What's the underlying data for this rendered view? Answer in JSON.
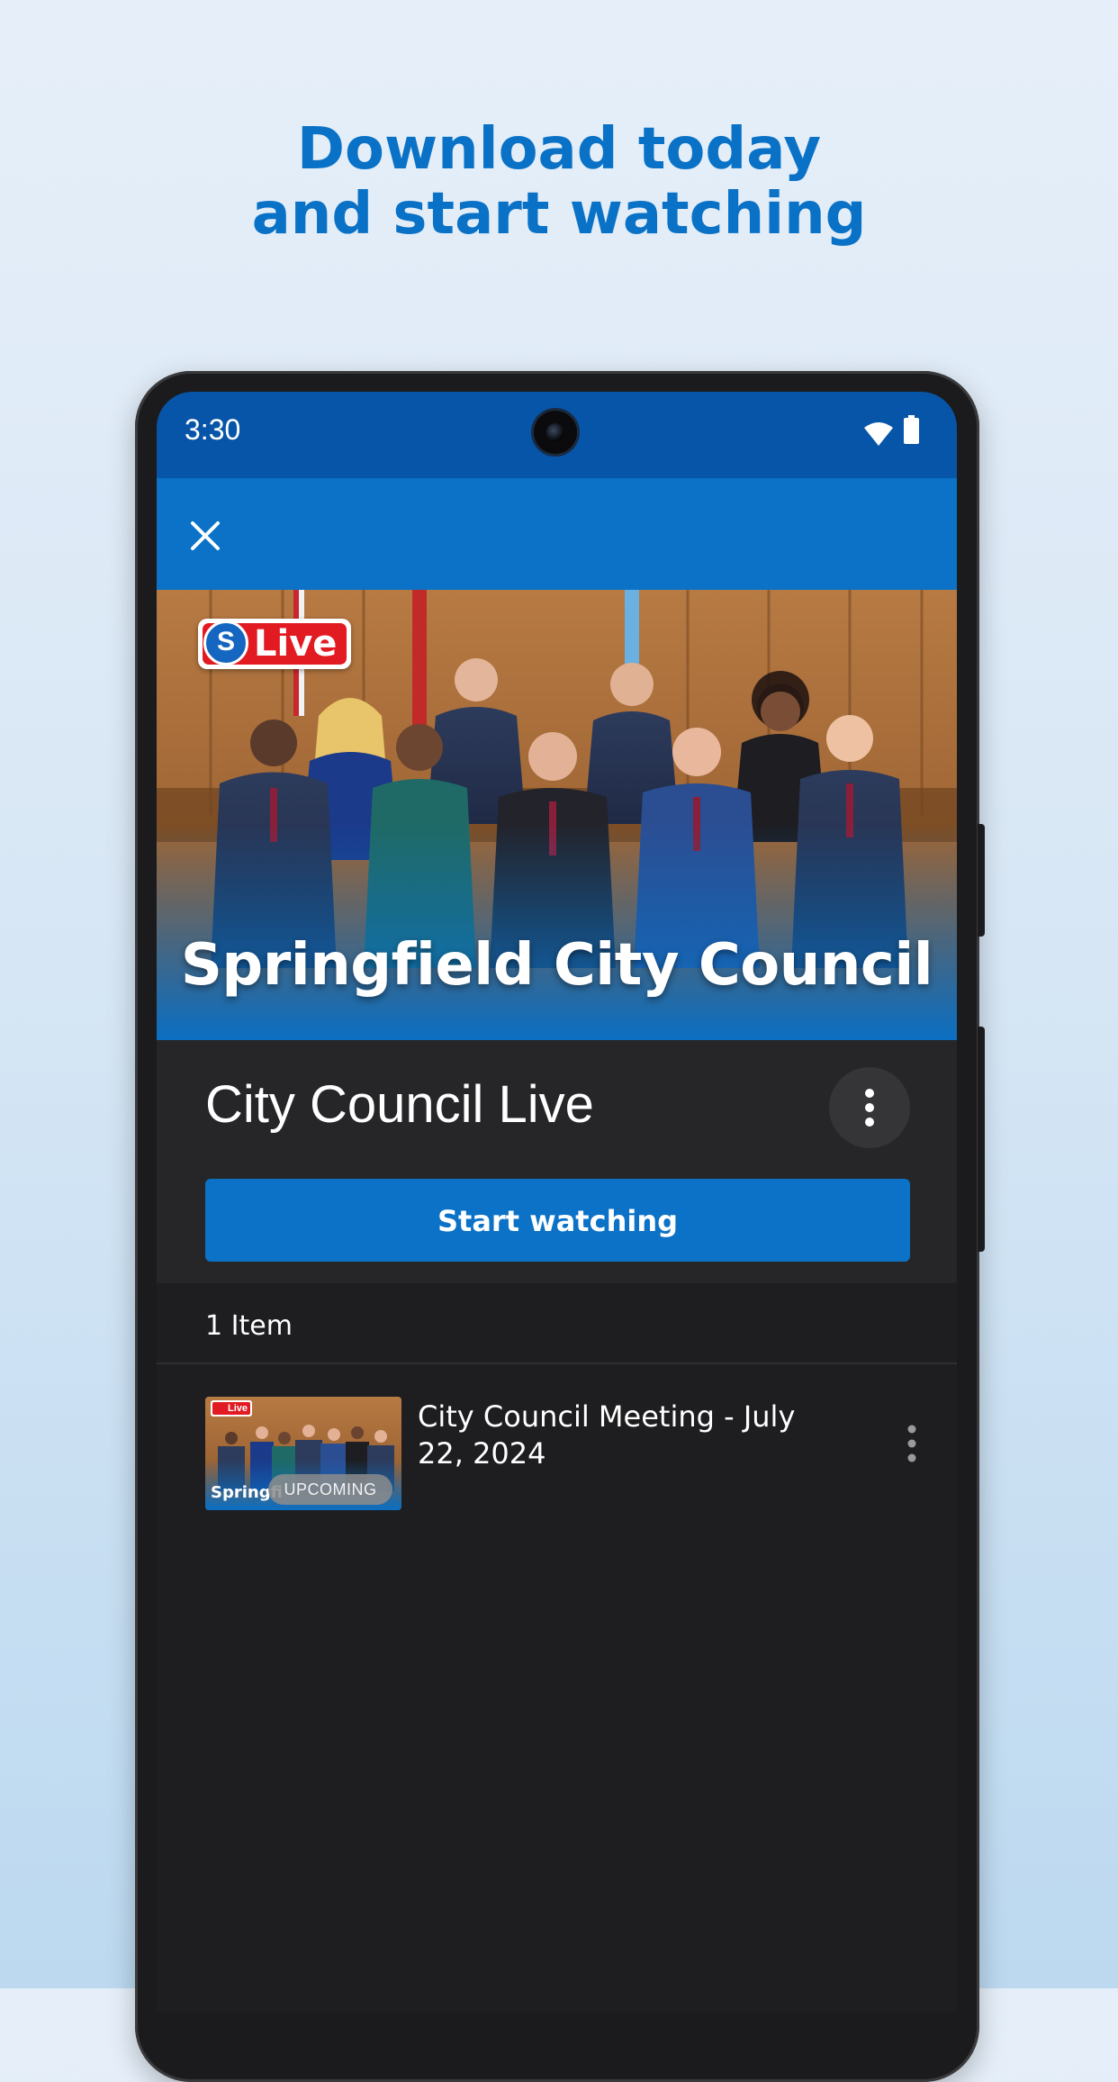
{
  "promo": {
    "headline_line1": "Download today",
    "headline_line2": "and start watching"
  },
  "status_bar": {
    "time": "3:30",
    "icons": [
      "wifi-icon",
      "battery-icon"
    ]
  },
  "app_bar": {
    "close_icon": "close-icon"
  },
  "hero": {
    "live_badge_logo": "S",
    "live_badge_text": "Live",
    "title": "Springfield City Council"
  },
  "program": {
    "title": "City Council Live",
    "more_icon": "more-vertical-icon",
    "start_button_label": "Start watching"
  },
  "list": {
    "count_label": "1 Item",
    "items": [
      {
        "title": "City Council Meeting - July 22, 2024",
        "badge": "UPCOMING",
        "thumb_caption": "Springfi",
        "thumb_live": "Live",
        "more_icon": "more-vertical-icon"
      }
    ]
  },
  "colors": {
    "accent": "#0b72c7",
    "status_bar": "#0755a8",
    "headline": "#0a72c6",
    "surface": "#262628",
    "background_dark": "#1e1e20",
    "live_red": "#e21b23"
  }
}
